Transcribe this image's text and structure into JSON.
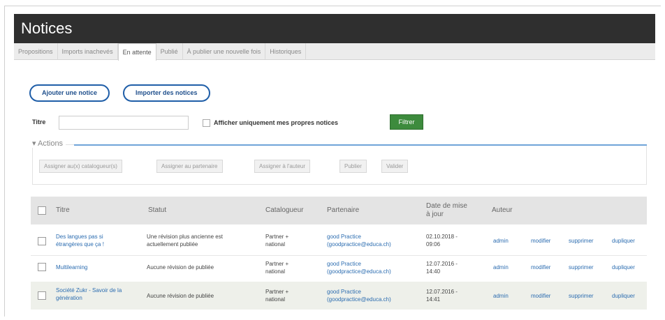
{
  "page": {
    "title": "Notices"
  },
  "tabs": [
    "Propositions",
    "Imports inachevés",
    "En attente",
    "Publié",
    "À publier une nouvelle fois",
    "Historiques"
  ],
  "buttons": {
    "add": "Ajouter une notice",
    "import": "Importer des notices",
    "filter": "Filtrer"
  },
  "filters": {
    "title_label": "Titre",
    "title_value": "",
    "mine_label": "Afficher uniquement mes propres notices",
    "mine_checked": false
  },
  "actions": {
    "legend": "Actions",
    "buttons": [
      "Assigner au(x) catalogueur(s)",
      "Assigner au partenaire",
      "Assigner à l'auteur",
      "Publier",
      "Valider"
    ]
  },
  "table": {
    "columns": [
      "Titre",
      "Statut",
      "Catalogueur",
      "Partenaire",
      "Date de mise à jour",
      "Auteur"
    ],
    "rows": [
      {
        "title_1": "Des langues pas si",
        "title_2": "étrangères que ça !",
        "status_1": "Une révision plus ancienne est",
        "status_2": "actuellement publiée",
        "catalog_1": "Partner +",
        "catalog_2": "national",
        "partner_1": "good Practice",
        "partner_2": "(goodpractice@educa.ch)",
        "date_1": "02.10.2018 -",
        "date_2": "09:06",
        "author": "admin",
        "edit": "modifier",
        "delete": "supprimer",
        "duplicate": "dupliquer"
      },
      {
        "title_1": "Multilearning",
        "title_2": "",
        "status_1": "Aucune révision de publiée",
        "status_2": "",
        "catalog_1": "Partner +",
        "catalog_2": "national",
        "partner_1": "good Practice",
        "partner_2": "(goodpractice@educa.ch)",
        "date_1": "12.07.2016 -",
        "date_2": "14:40",
        "author": "admin",
        "edit": "modifier",
        "delete": "supprimer",
        "duplicate": "dupliquer"
      },
      {
        "title_1": "Société Zukr - Savoir de la",
        "title_2": "génération",
        "status_1": "Aucune révision de publiée",
        "status_2": "",
        "catalog_1": "Partner +",
        "catalog_2": "national",
        "partner_1": "good Practice",
        "partner_2": "(goodpractice@educa.ch)",
        "date_1": "12.07.2016 -",
        "date_2": "14:41",
        "author": "admin",
        "edit": "modifier",
        "delete": "supprimer",
        "duplicate": "dupliquer"
      }
    ]
  }
}
